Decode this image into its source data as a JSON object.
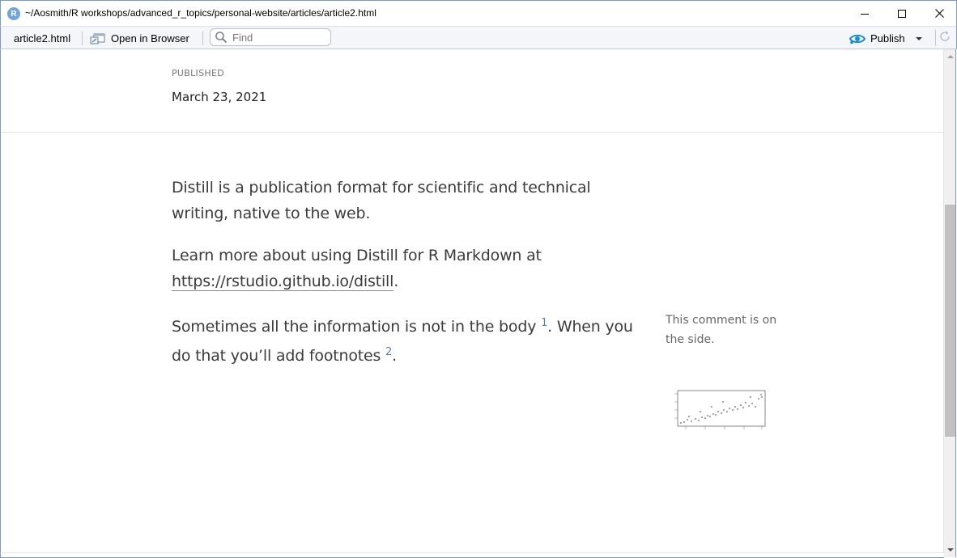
{
  "window": {
    "app_icon_letter": "R",
    "title": "~/Aosmith/R workshops/advanced_r_topics/personal-website/articles/article2.html"
  },
  "toolbar": {
    "filename": "article2.html",
    "open_in_browser_label": "Open in Browser",
    "find_placeholder": "Find",
    "publish_label": "Publish"
  },
  "article": {
    "published_label": "PUBLISHED",
    "published_date": "March 23, 2021",
    "paragraph1": "Distill is a publication format for scientific and technical writing, native to the web.",
    "paragraph2_prefix": "Learn more about using Distill for R Markdown at ",
    "paragraph2_link": "https://rstudio.github.io/distill",
    "paragraph2_suffix": ".",
    "paragraph3_part1": "Sometimes all the information is not in the body ",
    "footnote1": "1",
    "paragraph3_part2": ". When you do that you’ll add footnotes ",
    "footnote2": "2",
    "paragraph3_part3": "."
  },
  "sidebar": {
    "comment": "This comment is on the side."
  },
  "colors": {
    "accent_blue": "#1a8ccf",
    "window_border": "#7a9bc4"
  },
  "icons": {
    "app": "r-logo-icon",
    "open_in_browser": "browser-window-icon",
    "find": "magnifier-icon",
    "publish": "publish-eye-icon",
    "refresh": "refresh-icon"
  }
}
